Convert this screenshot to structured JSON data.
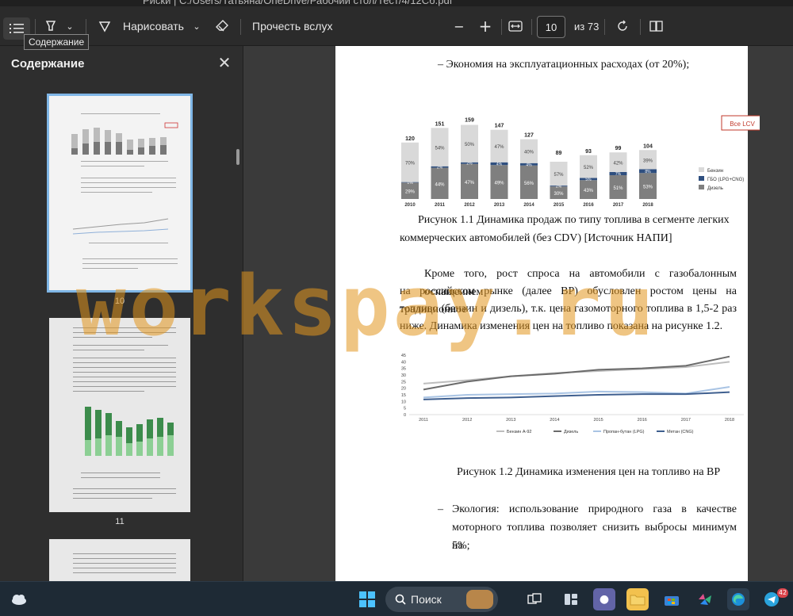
{
  "window": {
    "title_path": "Риски    |    C:/Users/Татьяна/OneDrive/Рабочий стол/Тест/4/12Сб.pdf"
  },
  "toolbar": {
    "contents_tooltip": "Содержание",
    "draw_label": "Нарисовать",
    "read_aloud_label": "Прочесть вслух",
    "page_current": "10",
    "page_total_label": "из 73"
  },
  "sidebar": {
    "title": "Содержание",
    "thumbnails": [
      {
        "page": "10",
        "active": true
      },
      {
        "page": "11",
        "active": false
      }
    ]
  },
  "document": {
    "bullet_1": "–   Экономия на эксплуатационных расходах (от 20%);",
    "chart_caption_1_line1": "Рисунок 1.1 Динамика продаж по типу топлива в сегменте легких",
    "chart_caption_1_line2": "коммерческих автомобилей (без CDV) [Источник НАПИ]",
    "para_line1": "Кроме того, рост спроса на автомобили с газобалонным оснащением",
    "para_line2": "на российском рынке (далее ВР) обусловлен ростом цены на традиционное",
    "para_line3": "топливо (бензин и дизель), т.к. цена газомоторного  топлива в 1,5-2 раз",
    "para_line4": "ниже. Динамика изменения цен на топливо показана на рисунке 1.2.",
    "chart_caption_2": "Рисунок 1.2 Динамика изменения цен на топливо на ВР",
    "bullet_2_line1": "Экология:  использование  природного  газа  в  качестве",
    "bullet_2_line2": "моторного топлива позволяет снизить выбросы минимум на",
    "bullet_2_line3": "5%;",
    "bullet_2_dash": "–"
  },
  "watermark": "workspay.ru",
  "taskbar": {
    "search_label": "Поиск",
    "telegram_badge": "42"
  },
  "chart_data": [
    {
      "type": "bar",
      "title": "",
      "annotation": "Все LCV",
      "categories": [
        "2010",
        "2011",
        "2012",
        "2013",
        "2014",
        "2015",
        "2016",
        "2017",
        "2018"
      ],
      "totals": [
        120,
        151,
        159,
        147,
        127,
        89,
        93,
        99,
        104
      ],
      "series": [
        {
          "name": "Бензин",
          "values": [
            70,
            54,
            50,
            47,
            40,
            57,
            52,
            42,
            39
          ],
          "unit": "%",
          "color": "#d9d9d9"
        },
        {
          "name": "ГБО (LPG+CNG)",
          "values": [
            1,
            2,
            2,
            4,
            4,
            2,
            5,
            7,
            8
          ],
          "unit": "%",
          "color": "#2f4f7f"
        },
        {
          "name": "Дизель",
          "values": [
            29,
            44,
            47,
            49,
            56,
            30,
            43,
            51,
            53
          ],
          "unit": "%",
          "color": "#7f7f7f"
        }
      ],
      "legend": "right"
    },
    {
      "type": "line",
      "title": "",
      "x": [
        "2011",
        "2012",
        "2013",
        "2014",
        "2015",
        "2016",
        "2017",
        "2018"
      ],
      "ylim": [
        0,
        45
      ],
      "yticks": [
        0,
        5,
        10,
        15,
        20,
        25,
        30,
        35,
        40,
        45
      ],
      "series": [
        {
          "name": "Бензин А-92",
          "values": [
            23.5,
            26,
            29,
            31.5,
            33,
            34.5,
            36,
            40
          ],
          "color": "#bdbdbd"
        },
        {
          "name": "Дизель",
          "values": [
            19,
            25,
            29,
            31,
            34,
            35,
            37,
            44
          ],
          "color": "#6b6b6b"
        },
        {
          "name": "Пропан-бутан (LPG)",
          "values": [
            13,
            15,
            15.5,
            16,
            17.5,
            17,
            16,
            21
          ],
          "color": "#a9c4e4"
        },
        {
          "name": "Метан (CNG)",
          "values": [
            11.5,
            12.5,
            13,
            14,
            15,
            15.5,
            15.5,
            17
          ],
          "color": "#3f5f8f"
        }
      ],
      "legend": "bottom"
    }
  ]
}
